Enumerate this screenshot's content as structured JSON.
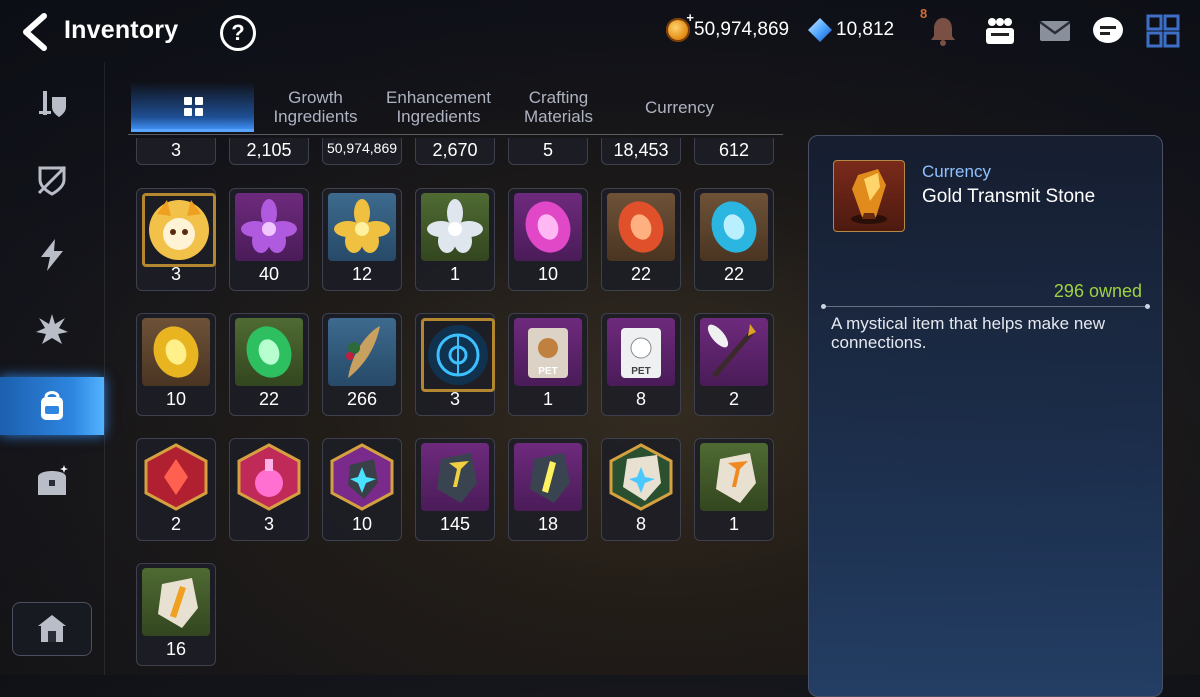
{
  "header": {
    "title": "Inventory",
    "help_label": "?",
    "gold": "50,974,869",
    "crystals": "10,812",
    "notification_count": "8"
  },
  "tabs": [
    {
      "label": "",
      "icon": "grid-icon",
      "active": true
    },
    {
      "label": "Growth Ingredients"
    },
    {
      "label": "Enhancement Ingredients"
    },
    {
      "label": "Crafting Materials"
    },
    {
      "label": "Currency"
    }
  ],
  "sidebar": [
    {
      "icon": "sword-shield-icon"
    },
    {
      "icon": "broken-shield-icon"
    },
    {
      "icon": "lightning-icon"
    },
    {
      "icon": "burst-icon"
    },
    {
      "icon": "backpack-icon",
      "active": true
    },
    {
      "icon": "chest-icon"
    },
    {
      "icon": "house-icon"
    }
  ],
  "grid": {
    "top_row": [
      "3",
      "2,105",
      "50,974,869",
      "2,670",
      "5",
      "18,453",
      "612"
    ],
    "rows": [
      [
        {
          "icon": "cat-mascot-icon",
          "qty": "3"
        },
        {
          "icon": "purple-flower-icon",
          "qty": "40"
        },
        {
          "icon": "gold-flower-icon",
          "qty": "12"
        },
        {
          "icon": "silver-flower-icon",
          "qty": "1"
        },
        {
          "icon": "pink-rune-icon",
          "qty": "10"
        },
        {
          "icon": "red-rune-icon",
          "qty": "22"
        },
        {
          "icon": "cyan-rune-icon",
          "qty": "22"
        }
      ],
      [
        {
          "icon": "yellow-rune-icon",
          "qty": "10"
        },
        {
          "icon": "green-rune-icon",
          "qty": "22"
        },
        {
          "icon": "feather-icon",
          "qty": "266"
        },
        {
          "icon": "blue-sigil-icon",
          "qty": "3"
        },
        {
          "icon": "pet-bag-icon",
          "qty": "1"
        },
        {
          "icon": "pet-bag-white-icon",
          "qty": "8"
        },
        {
          "icon": "feather-wand-icon",
          "qty": "2"
        }
      ],
      [
        {
          "icon": "red-gem-icon",
          "qty": "2"
        },
        {
          "icon": "potion-icon",
          "qty": "3"
        },
        {
          "icon": "cyan-stone-icon",
          "qty": "10"
        },
        {
          "icon": "gold-stone-icon",
          "qty": "145"
        },
        {
          "icon": "yellow-stone-icon",
          "qty": "18"
        },
        {
          "icon": "star-stone-icon",
          "qty": "8"
        },
        {
          "icon": "orange-stone-icon",
          "qty": "1"
        }
      ],
      [
        {
          "icon": "light-stone-icon",
          "qty": "16"
        }
      ]
    ]
  },
  "detail": {
    "category": "Currency",
    "name": "Gold Transmit Stone",
    "owned": "296 owned",
    "description": "A mystical item that helps make new connections."
  },
  "colors": {
    "accent_blue": "#3e8cf0",
    "owned_green": "#9fd142",
    "category_blue": "#8fc1ff"
  }
}
